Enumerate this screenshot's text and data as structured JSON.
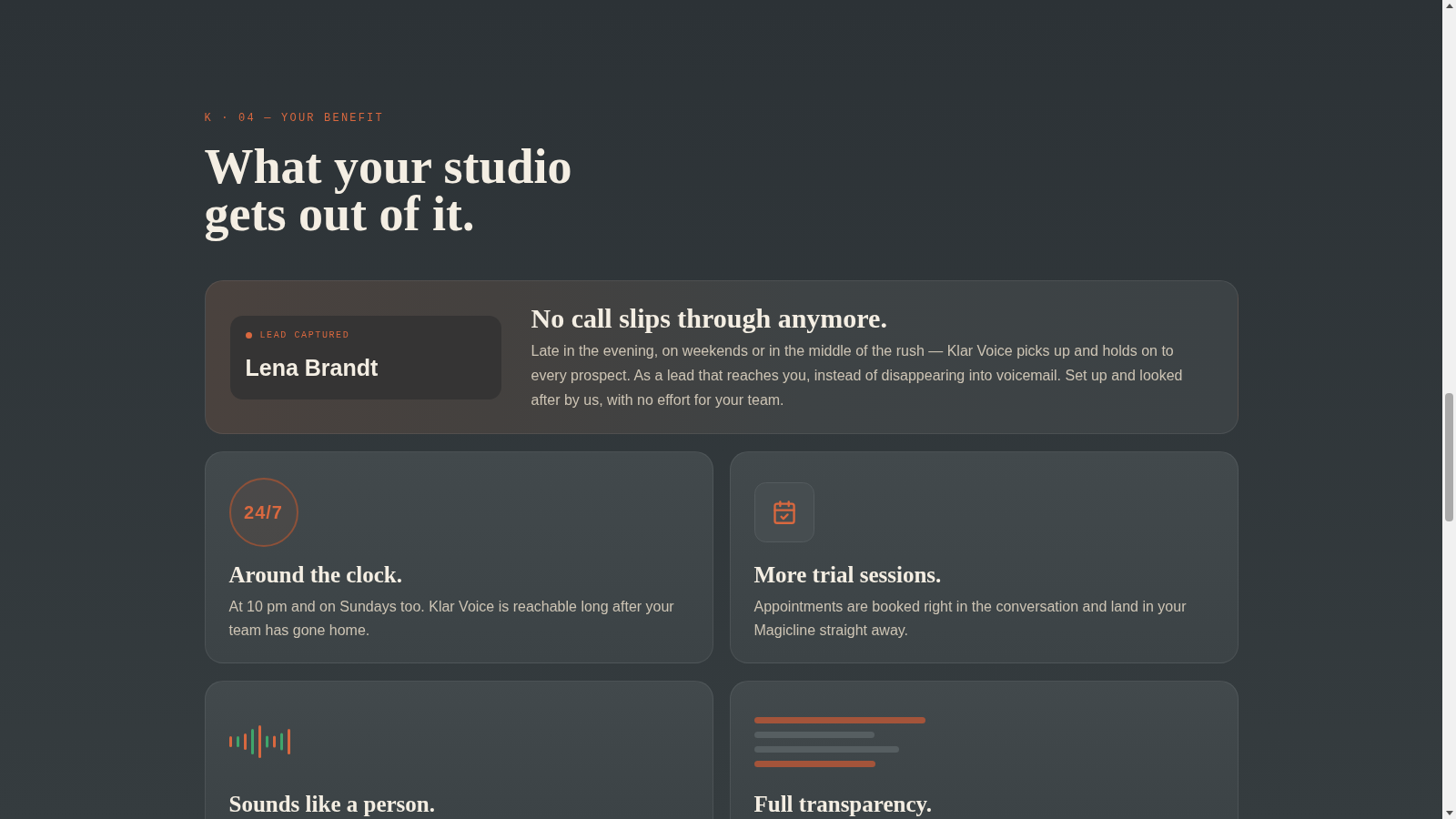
{
  "section": {
    "eyebrow": "K · 04 — YOUR BENEFIT",
    "heading": "What your studio gets out of it."
  },
  "feature": {
    "lead": {
      "status": "LEAD CAPTURED",
      "name": "Lena Brandt"
    },
    "title": "No call slips through anymore.",
    "body": "Late in the evening, on weekends or in the middle of the rush — Klar Voice picks up and holds on to every prospect. As a lead that reaches you, instead of disappearing into voicemail. Set up and looked after by us, with no effort for your team."
  },
  "cards": [
    {
      "kind": "badge",
      "badge": "24/7",
      "title": "Around the clock.",
      "body": "At 10 pm and on Sundays too. Klar Voice is reachable long after your team has gone home."
    },
    {
      "kind": "calendar",
      "title": "More trial sessions.",
      "body": "Appointments are booked right in the conversation and land in your Magicline straight away."
    },
    {
      "kind": "waveform",
      "title": "Sounds like a person."
    },
    {
      "kind": "lines",
      "title": "Full transparency."
    }
  ]
}
